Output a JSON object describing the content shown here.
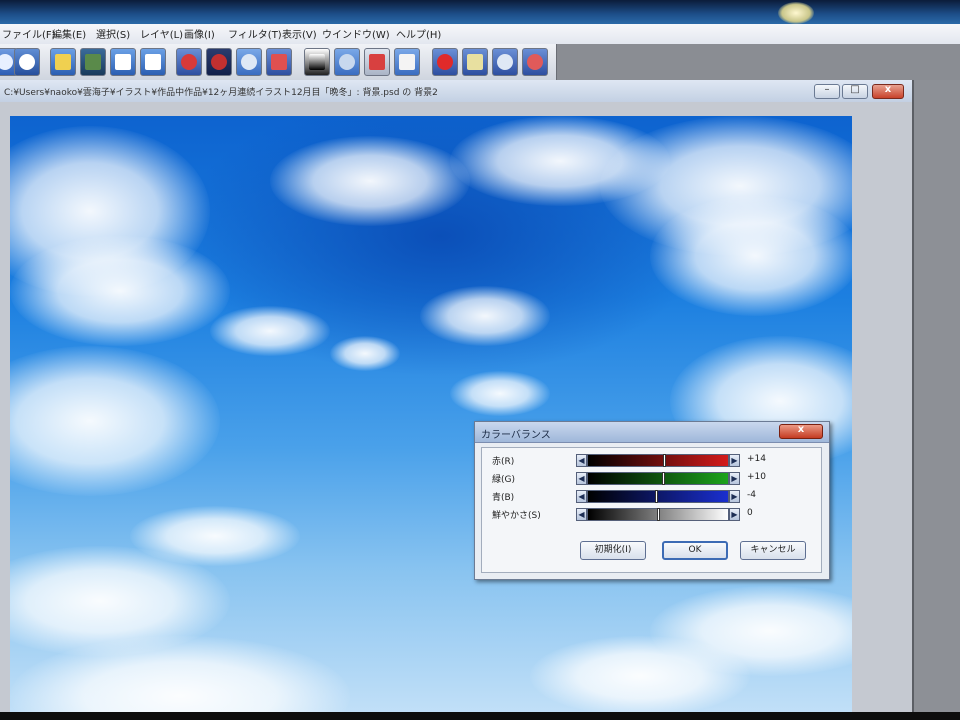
{
  "menubar": {
    "items": [
      "ファイル(F)",
      "編集(E)",
      "選択(S)",
      "レイヤ(L)",
      "画像(I)",
      "フィルタ(T)",
      "表示(V)",
      "ウインドウ(W)",
      "ヘルプ(H)"
    ]
  },
  "toolbar": {
    "icons": [
      "new-file-icon",
      "open-file-icon",
      "undo-icon",
      "redo-icon",
      "copy-icon",
      "paste-icon",
      "brush-icon",
      "pen-icon",
      "globe-icon",
      "eraser-icon",
      "gradient-icon",
      "layer-icon",
      "fill-icon",
      "shape-icon",
      "record-icon",
      "eyedropper-icon",
      "zoom-in-icon",
      "zoom-out-icon"
    ]
  },
  "document": {
    "title": "C:¥Users¥naoko¥雲海子¥イラスト¥作品中作品¥12ヶ月連続イラスト12月目「晩冬」: 背景.psd の 背景2"
  },
  "window_controls": {
    "minimize": "–",
    "maximize": "□",
    "close": "x"
  },
  "dialog": {
    "title": "カラーバランス",
    "close_label": "x",
    "sliders": [
      {
        "label": "赤(R)",
        "value": "+14",
        "position": 0.55,
        "color": "#d41b1b"
      },
      {
        "label": "緑(G)",
        "value": "+10",
        "position": 0.54,
        "color": "#1ca31c"
      },
      {
        "label": "青(B)",
        "value": "-4",
        "position": 0.49,
        "color": "#1a2fd0"
      },
      {
        "label": "鮮やかさ(S)",
        "value": "0",
        "position": 0.5,
        "color": "#ffffff"
      }
    ],
    "buttons": {
      "reset": "初期化(I)",
      "ok": "OK",
      "cancel": "キャンセル"
    }
  },
  "colors": {
    "sky_top": "#0d63cf",
    "sky_bottom": "#c4e1f8",
    "dialog_bg": "#e9edf3"
  }
}
